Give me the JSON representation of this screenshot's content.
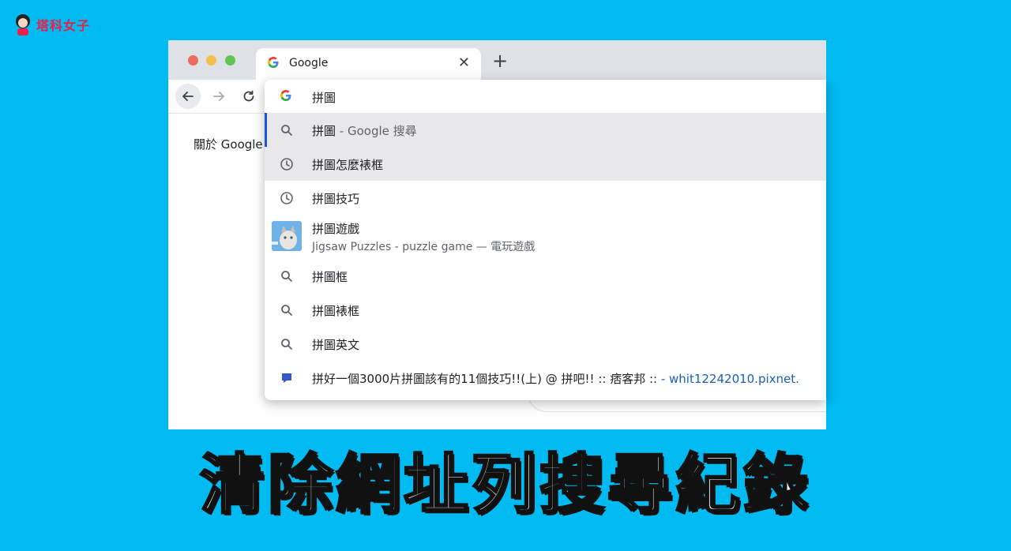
{
  "brand": {
    "name": "塔科女子"
  },
  "tab": {
    "title": "Google",
    "favicon": "G"
  },
  "page": {
    "link_text": "關於 Google"
  },
  "omnibox": {
    "query": "拼圖",
    "suggestions": [
      {
        "icon": "search-icon",
        "text": "拼圖",
        "suffix": " - Google 搜尋"
      },
      {
        "icon": "history-icon",
        "text": "拼圖怎麼裱框"
      },
      {
        "icon": "history-icon",
        "text": "拼圖技巧"
      },
      {
        "icon": "app-thumbnail",
        "text": "拼圖遊戲",
        "subtitle": "Jigsaw Puzzles - puzzle game — 電玩遊戲"
      },
      {
        "icon": "search-icon",
        "text": "拼圖框"
      },
      {
        "icon": "search-icon",
        "text": "拼圖裱框"
      },
      {
        "icon": "search-icon",
        "text": "拼圖英文"
      },
      {
        "icon": "bookmark-icon",
        "text": "拼好一個3000片拼圖該有的11個技巧!!(上) @ 拼吧!! :: 痞客邦 :: ",
        "url": "- whit12242010.pixnet."
      }
    ]
  },
  "caption": "清除網址列搜尋紀錄",
  "colors": {
    "background": "#00baf2",
    "brand_red": "#e8204a",
    "link_blue": "#1a5fb4"
  }
}
